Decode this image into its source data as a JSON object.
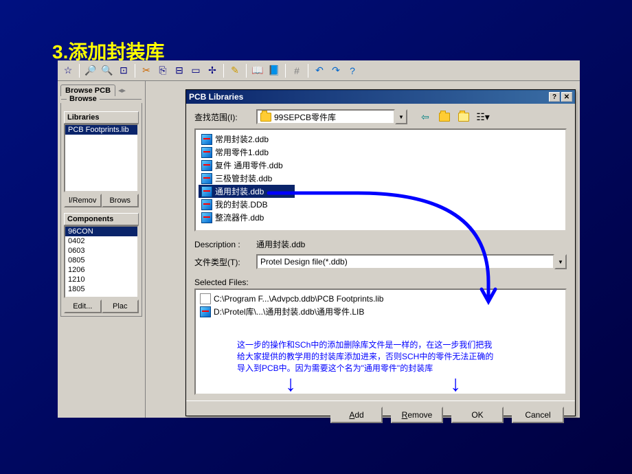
{
  "slide": {
    "title": "3.添加封装库"
  },
  "leftPanel": {
    "tab": "Browse PCB",
    "groupLabel": "Browse",
    "librariesHeader": "Libraries",
    "libraryItem": "PCB Footprints.lib",
    "removeBtn": "l/Remov",
    "browseBtn": "Brows",
    "componentsHeader": "Components",
    "components": [
      "96CON",
      "0402",
      "0603",
      "0805",
      "1206",
      "1210",
      "1805"
    ],
    "editBtn": "Edit...",
    "placeBtn": "Plac"
  },
  "dialog": {
    "title": "PCB Libraries",
    "lookInLabel": "查找范围(I):",
    "lookInValue": "99SEPCB零件库",
    "files": [
      {
        "name": "常用封装2.ddb"
      },
      {
        "name": "常用零件1.ddb"
      },
      {
        "name": "复件 通用零件.ddb"
      },
      {
        "name": "三极管封装.ddb"
      },
      {
        "name": "通用封装.ddb",
        "selected": true
      },
      {
        "name": "我的封装.DDB"
      },
      {
        "name": "整流器件.ddb"
      }
    ],
    "descriptionLabel": "Description :",
    "descriptionValue": "通用封装.ddb",
    "fileTypeLabel": "文件类型(T):",
    "fileTypeValue": "Protel Design file(*.ddb)",
    "selectedFilesLabel": "Selected Files:",
    "selectedFiles": [
      "C:\\Program F...\\Advpcb.ddb\\PCB Footprints.lib",
      "D:\\Protel库\\...\\通用封装.ddb\\通用零件.LIB"
    ],
    "annotation": "这一步的操作和SCh中的添加删除库文件是一样的，在这一步我们把我给大家提供的教学用的封装库添加进来，否则SCH中的零件无法正确的导入到PCB中。因为需要这个名为\"通用零件\"的封装库",
    "buttons": {
      "add": "Add",
      "remove": "Remove",
      "ok": "OK",
      "cancel": "Cancel"
    }
  }
}
